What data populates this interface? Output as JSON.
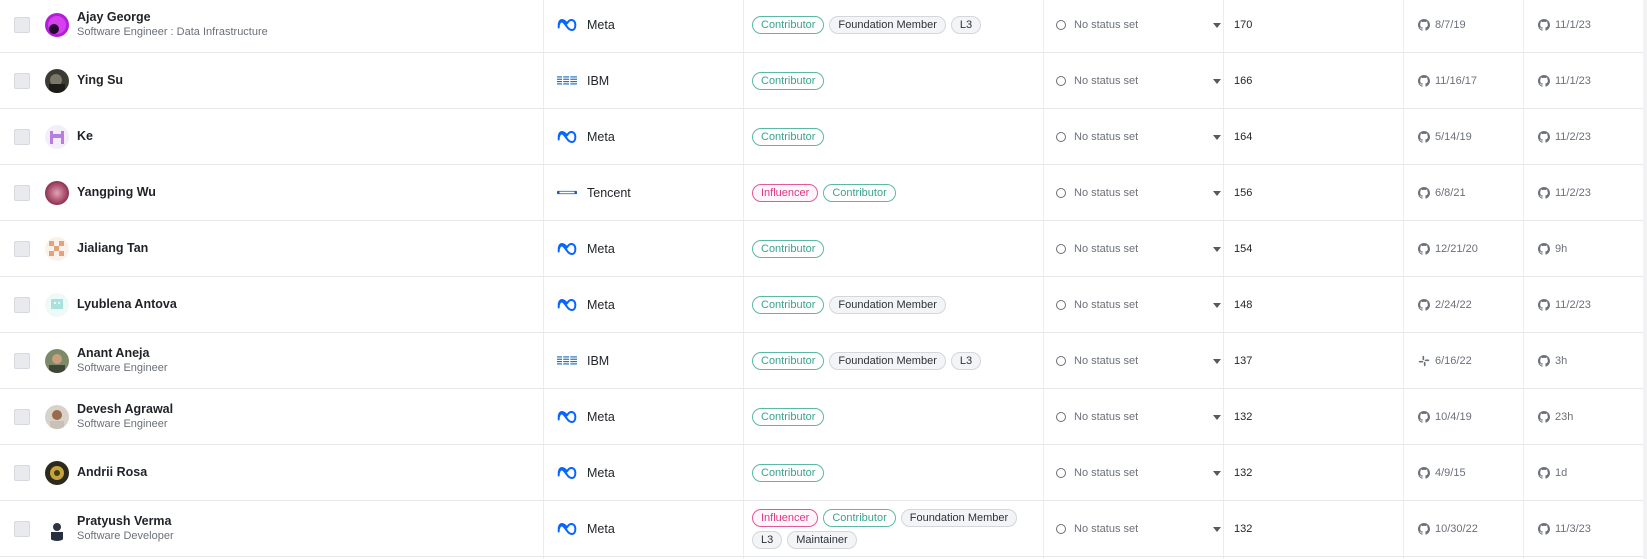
{
  "rows": [
    {
      "name": "Ajay George",
      "title": "Software Engineer : Data Infrastructure",
      "avatar": "ajay",
      "org": "Meta",
      "org_logo": "meta",
      "tags": [
        [
          "Contributor",
          "contributor"
        ],
        [
          "Foundation Member",
          "gray"
        ],
        [
          "L3",
          "gray"
        ]
      ],
      "status": "No status set",
      "count": "170",
      "first_icon": "github-icon",
      "first": "8/7/19",
      "last_icon": "github-icon",
      "last": "11/1/23"
    },
    {
      "name": "Ying Su",
      "title": "",
      "avatar": "ying",
      "org": "IBM",
      "org_logo": "ibm",
      "tags": [
        [
          "Contributor",
          "contributor"
        ]
      ],
      "status": "No status set",
      "count": "166",
      "first_icon": "github-icon",
      "first": "11/16/17",
      "last_icon": "github-icon",
      "last": "11/1/23"
    },
    {
      "name": "Ke",
      "title": "",
      "avatar": "ke",
      "org": "Meta",
      "org_logo": "meta",
      "tags": [
        [
          "Contributor",
          "contributor"
        ]
      ],
      "status": "No status set",
      "count": "164",
      "first_icon": "github-icon",
      "first": "5/14/19",
      "last_icon": "github-icon",
      "last": "11/2/23"
    },
    {
      "name": "Yangping Wu",
      "title": "",
      "avatar": "yangping",
      "org": "Tencent",
      "org_logo": "tencent",
      "tags": [
        [
          "Influencer",
          "influencer"
        ],
        [
          "Contributor",
          "contributor"
        ]
      ],
      "status": "No status set",
      "count": "156",
      "first_icon": "github-icon",
      "first": "6/8/21",
      "last_icon": "github-icon",
      "last": "11/2/23"
    },
    {
      "name": "Jialiang Tan",
      "title": "",
      "avatar": "jialiang",
      "org": "Meta",
      "org_logo": "meta",
      "tags": [
        [
          "Contributor",
          "contributor"
        ]
      ],
      "status": "No status set",
      "count": "154",
      "first_icon": "github-icon",
      "first": "12/21/20",
      "last_icon": "github-icon",
      "last": "9h"
    },
    {
      "name": "Lyublena Antova",
      "title": "",
      "avatar": "lyublena",
      "org": "Meta",
      "org_logo": "meta",
      "tags": [
        [
          "Contributor",
          "contributor"
        ],
        [
          "Foundation Member",
          "gray"
        ]
      ],
      "status": "No status set",
      "count": "148",
      "first_icon": "github-icon",
      "first": "2/24/22",
      "last_icon": "github-icon",
      "last": "11/2/23"
    },
    {
      "name": "Anant Aneja",
      "title": "Software Engineer",
      "avatar": "anant",
      "org": "IBM",
      "org_logo": "ibm",
      "tags": [
        [
          "Contributor",
          "contributor"
        ],
        [
          "Foundation Member",
          "gray"
        ],
        [
          "L3",
          "gray"
        ]
      ],
      "status": "No status set",
      "count": "137",
      "first_icon": "slack-icon",
      "first": "6/16/22",
      "last_icon": "github-icon",
      "last": "3h"
    },
    {
      "name": "Devesh Agrawal",
      "title": "Software Engineer",
      "avatar": "devesh",
      "org": "Meta",
      "org_logo": "meta",
      "tags": [
        [
          "Contributor",
          "contributor"
        ]
      ],
      "status": "No status set",
      "count": "132",
      "first_icon": "github-icon",
      "first": "10/4/19",
      "last_icon": "github-icon",
      "last": "23h"
    },
    {
      "name": "Andrii Rosa",
      "title": "",
      "avatar": "andrii",
      "org": "Meta",
      "org_logo": "meta",
      "tags": [
        [
          "Contributor",
          "contributor"
        ]
      ],
      "status": "No status set",
      "count": "132",
      "first_icon": "github-icon",
      "first": "4/9/15",
      "last_icon": "github-icon",
      "last": "1d"
    },
    {
      "name": "Pratyush Verma",
      "title": "Software Developer",
      "avatar": "pratyush",
      "org": "Meta",
      "org_logo": "meta",
      "tags": [
        [
          "Influencer",
          "influencer"
        ],
        [
          "Contributor",
          "contributor"
        ],
        [
          "Foundation Member",
          "gray"
        ],
        [
          "L3",
          "gray"
        ],
        [
          "Maintainer",
          "gray"
        ]
      ],
      "status": "No status set",
      "count": "132",
      "first_icon": "github-icon",
      "first": "10/30/22",
      "last_icon": "github-icon",
      "last": "11/3/23"
    }
  ],
  "colors": {
    "contributor": "#3aa38d",
    "influencer": "#d63b86",
    "meta_blue": "#0866ff",
    "ibm_blue": "#1f70c1"
  }
}
